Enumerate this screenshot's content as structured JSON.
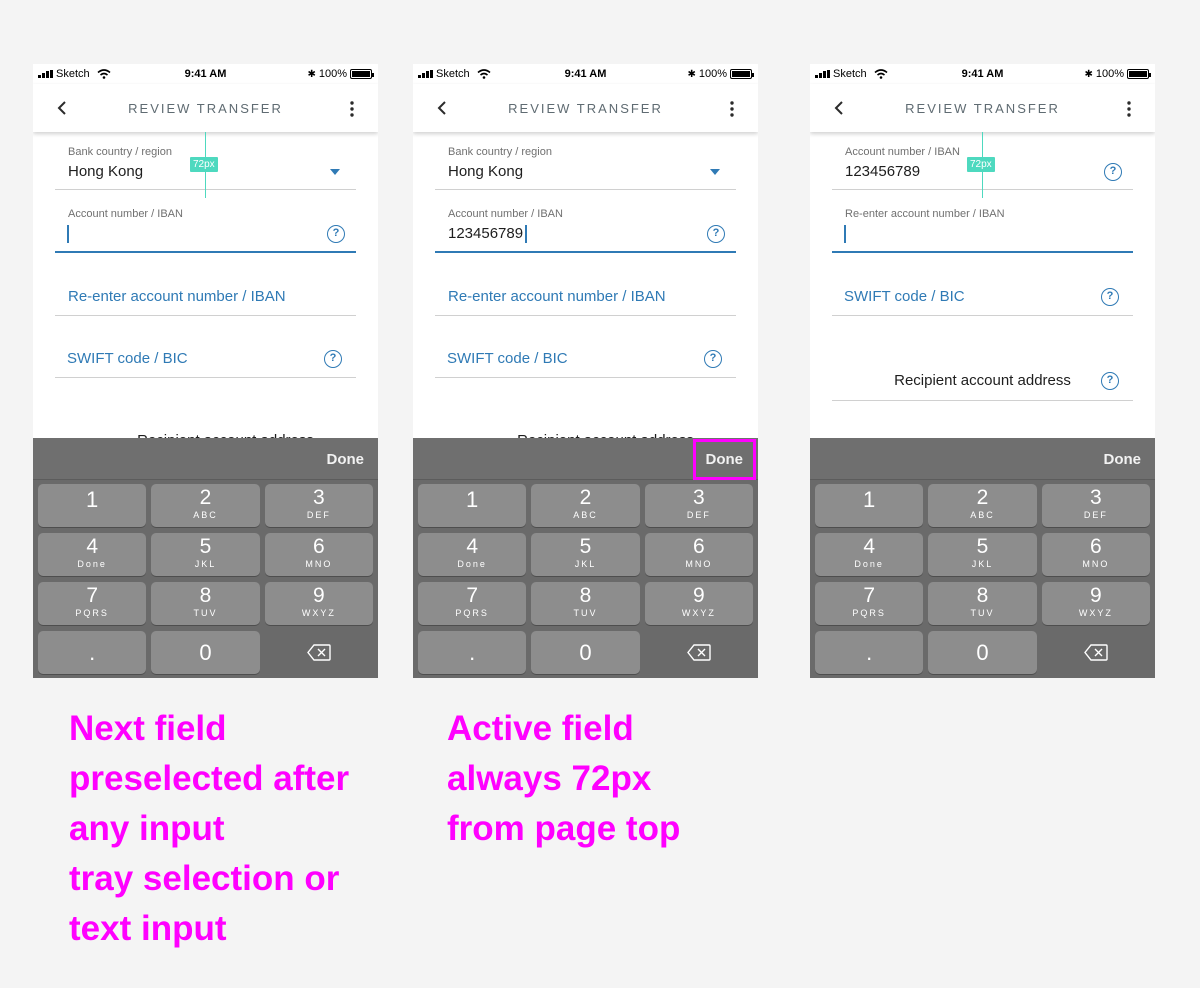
{
  "status": {
    "carrier": "Sketch",
    "time": "9:41 AM",
    "battery": "100%"
  },
  "nav": {
    "title": "REVIEW TRANSFER"
  },
  "fields": {
    "bank_country_label": "Bank country / region",
    "bank_country_value": "Hong Kong",
    "account_label": "Account number / IBAN",
    "account_value": "123456789",
    "reenter_placeholder": "Re-enter account number / IBAN",
    "reenter_label": "Re-enter account number / IBAN",
    "swift_placeholder": "SWIFT code / BIC",
    "recipient_address": "Recipient account address",
    "recipient_address_partial": "Recipient account address",
    "help_symbol": "?"
  },
  "measure": {
    "tag": "72px"
  },
  "keyboard": {
    "done_label": "Done",
    "keys": [
      {
        "num": "1",
        "letters": ""
      },
      {
        "num": "2",
        "letters": "ABC"
      },
      {
        "num": "3",
        "letters": "DEF"
      },
      {
        "num": "4",
        "letters": "Done"
      },
      {
        "num": "5",
        "letters": "JKL"
      },
      {
        "num": "6",
        "letters": "MNO"
      },
      {
        "num": "7",
        "letters": "PQRS"
      },
      {
        "num": "8",
        "letters": "TUV"
      },
      {
        "num": "9",
        "letters": "WXYZ"
      }
    ],
    "dot": ".",
    "zero": "0"
  },
  "captions": {
    "left": "Next field\npreselected after\nany input\ntray selection or\ntext input",
    "right": "Active field\nalways 72px\nfrom page top"
  },
  "colors": {
    "accent": "#2f7ab5",
    "annotation": "#ff00ff",
    "measure": "#4ed9bf"
  },
  "icons": [
    "back-arrow-icon",
    "more-vertical-icon",
    "help-icon",
    "dropdown-caret-icon",
    "backspace-icon",
    "wifi-icon",
    "bluetooth-icon",
    "battery-icon"
  ]
}
